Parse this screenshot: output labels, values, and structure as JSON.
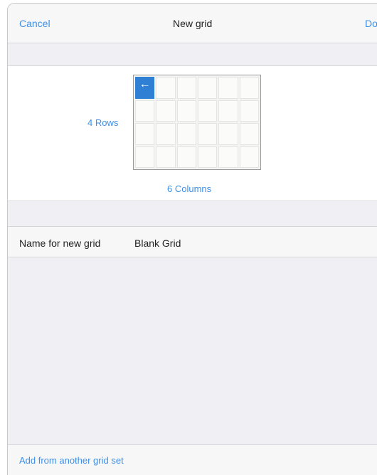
{
  "nav": {
    "cancel_label": "Cancel",
    "title": "New grid",
    "done_label": "Done"
  },
  "grid_size": {
    "rows_label": "4 Rows",
    "columns_label": "6 Columns",
    "rows": 4,
    "columns": 6,
    "first_cell_icon": "back-arrow-icon",
    "back_arrow_glyph": "←"
  },
  "name_field": {
    "label": "Name for new grid",
    "value": "Blank Grid"
  },
  "footer": {
    "add_from_label": "Add from another grid set"
  },
  "colors": {
    "accent": "#3d8fe6",
    "back_cell": "#2f7fd4"
  }
}
